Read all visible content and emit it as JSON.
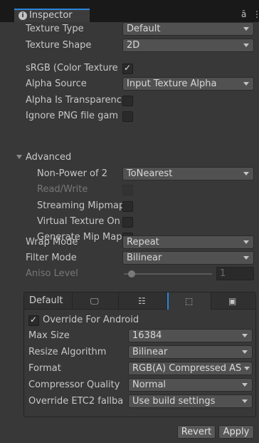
{
  "tab": {
    "title": "Inspector"
  },
  "fields": {
    "texture_type": {
      "label": "Texture Type",
      "value": "Default"
    },
    "texture_shape": {
      "label": "Texture Shape",
      "value": "2D"
    },
    "srgb": {
      "label": "sRGB (Color Texture",
      "checked": true
    },
    "alpha_source": {
      "label": "Alpha Source",
      "value": "Input Texture Alpha"
    },
    "alpha_transparency": {
      "label": "Alpha Is Transparenc",
      "checked": false
    },
    "ignore_png_gamma": {
      "label": "Ignore PNG file gam",
      "checked": false
    }
  },
  "advanced": {
    "label": "Advanced",
    "non_power_of_2": {
      "label": "Non-Power of 2",
      "value": "ToNearest"
    },
    "read_write": {
      "label": "Read/Write",
      "checked": false
    },
    "streaming_mipmaps": {
      "label": "Streaming Mipmap",
      "checked": false
    },
    "virtual_texture_only": {
      "label": "Virtual Texture On",
      "checked": false
    },
    "generate_mip_maps": {
      "label": "Generate Mip Map",
      "checked": false
    }
  },
  "sampling": {
    "wrap_mode": {
      "label": "Wrap Mode",
      "value": "Repeat"
    },
    "filter_mode": {
      "label": "Filter Mode",
      "value": "Bilinear"
    },
    "aniso_level": {
      "label": "Aniso Level",
      "value": "1"
    }
  },
  "platforms": {
    "default_tab": "Default",
    "override": {
      "label": "Override For Android",
      "checked": true
    },
    "max_size": {
      "label": "Max Size",
      "value": "16384"
    },
    "resize_algorithm": {
      "label": "Resize Algorithm",
      "value": "Bilinear"
    },
    "format": {
      "label": "Format",
      "value": "RGB(A) Compressed AS"
    },
    "compressor_quality": {
      "label": "Compressor Quality",
      "value": "Normal"
    },
    "override_etc2": {
      "label": "Override ETC2 fallba",
      "value": "Use build settings"
    }
  },
  "buttons": {
    "revert": "Revert",
    "apply": "Apply"
  }
}
